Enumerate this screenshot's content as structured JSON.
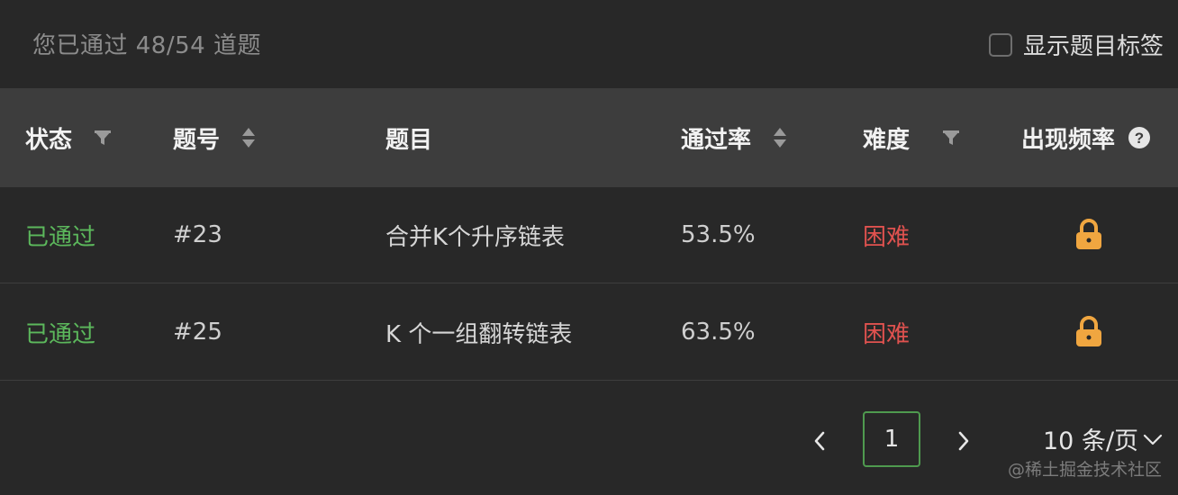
{
  "summary": "您已通过 48/54 道题",
  "show_tags": {
    "label": "显示题目标签",
    "checked": false
  },
  "columns": {
    "status": "状态",
    "number": "题号",
    "title": "题目",
    "pass_rate": "通过率",
    "difficulty": "难度",
    "frequency": "出现频率"
  },
  "rows": [
    {
      "status": "已通过",
      "number": "#23",
      "title": "合并K个升序链表",
      "pass_rate": "53.5%",
      "difficulty": "困难",
      "frequency_icon": "lock-icon"
    },
    {
      "status": "已通过",
      "number": "#25",
      "title": "K 个一组翻转链表",
      "pass_rate": "63.5%",
      "difficulty": "困难",
      "frequency_icon": "lock-icon"
    }
  ],
  "pagination": {
    "current_page": "1",
    "page_size": "10 条/页"
  },
  "watermark": "@稀土掘金技术社区",
  "colors": {
    "passed": "#5cb85c",
    "hard": "#e0524f",
    "lock": "#f0a640",
    "active_page_border": "#4f9a4f"
  }
}
